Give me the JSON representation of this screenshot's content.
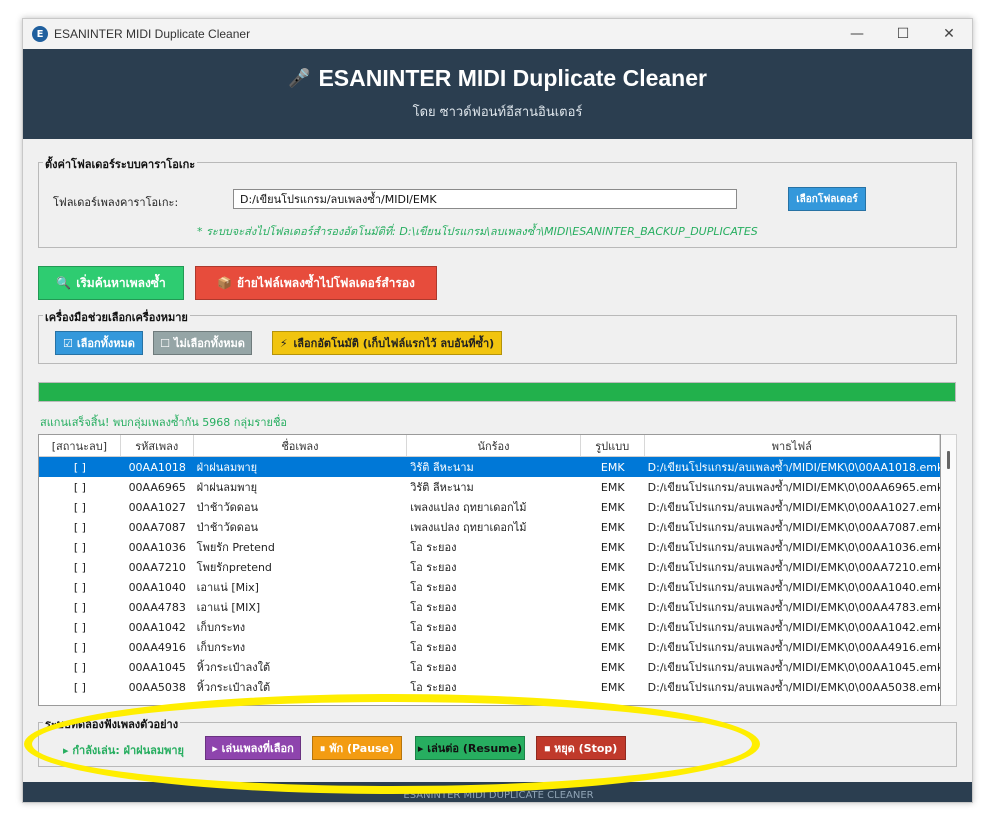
{
  "window": {
    "title": "ESANINTER MIDI Duplicate Cleaner",
    "icon_letter": "E",
    "controls": {
      "minimize": "—",
      "maximize": "☐",
      "close": "✕"
    }
  },
  "header": {
    "title": "ESANINTER MIDI Duplicate Cleaner",
    "icon": "microphone-icon",
    "subtitle": "โดย ซาวด์ฟอนท์อีสานอินเตอร์"
  },
  "folder_settings": {
    "group_title": "ตั้งค่าโฟลเดอร์ระบบคาราโอเกะ",
    "label": "โฟลเดอร์เพลงคาราโอเกะ:",
    "path_value": "D:/เขียนโปรแกรม/ลบเพลงซ้ำ/MIDI/EMK",
    "browse_button": "เลือกโฟลเดอร์",
    "backup_note": "* ระบบจะส่งไปโฟลเดอร์สำรองอัตโนมัติที่: D:\\เขียนโปรแกรม\\ลบเพลงซ้ำ\\MIDI\\ESANINTER_BACKUP_DUPLICATES"
  },
  "actions": {
    "scan_button": "เริ่มค้นหาเพลงซ้ำ",
    "move_button": "ย้ายไฟล์เพลงซ้ำไปโฟลเดอร์สำรอง"
  },
  "select_tools": {
    "group_title": "เครื่องมือช่วยเลือกเครื่องหมาย",
    "select_all": "เลือกทั้งหมด",
    "deselect_all": "ไม่เลือกทั้งหมด",
    "auto_select": "เลือกอัตโนมัติ (เก็บไฟล์แรกไว้ ลบอันที่ซ้ำ)"
  },
  "progress": {
    "fraction": 1.0
  },
  "status": "สแกนเสร็จสิ้น! พบกลุ่มเพลงซ้ำกัน 5968 กลุ่มรายชื่อ",
  "table": {
    "headers": [
      "[สถานะลบ]",
      "รหัสเพลง",
      "ชื่อเพลง",
      "นักร้อง",
      "รูปแบบ",
      "พาธไฟล์"
    ],
    "rows": [
      [
        "[  ]",
        "00AA1018",
        "ฝ่าฝนลมพายุ",
        "วิรัติ ลีหะนาม",
        "EMK",
        "D:/เขียนโปรแกรม/ลบเพลงซ้ำ/MIDI/EMK\\0\\00AA1018.emk"
      ],
      [
        "[  ]",
        "00AA6965",
        "ฝ่าฝนลมพายุ",
        "วิรัติ ลีหะนาม",
        "EMK",
        "D:/เขียนโปรแกรม/ลบเพลงซ้ำ/MIDI/EMK\\0\\00AA6965.emk"
      ],
      [
        "[  ]",
        "00AA1027",
        "ป่าช้าวัดดอน",
        "เพลงแปลง ฤทยาเดอกไม้",
        "EMK",
        "D:/เขียนโปรแกรม/ลบเพลงซ้ำ/MIDI/EMK\\0\\00AA1027.emk"
      ],
      [
        "[  ]",
        "00AA7087",
        "ป่าช้าวัดดอน",
        "เพลงแปลง ฤทยาเดอกไม้",
        "EMK",
        "D:/เขียนโปรแกรม/ลบเพลงซ้ำ/MIDI/EMK\\0\\00AA7087.emk"
      ],
      [
        "[  ]",
        "00AA1036",
        "โพยรัก Pretend",
        "โอ ระยอง",
        "EMK",
        "D:/เขียนโปรแกรม/ลบเพลงซ้ำ/MIDI/EMK\\0\\00AA1036.emk"
      ],
      [
        "[  ]",
        "00AA7210",
        "โพยรักpretend",
        "โอ ระยอง",
        "EMK",
        "D:/เขียนโปรแกรม/ลบเพลงซ้ำ/MIDI/EMK\\0\\00AA7210.emk"
      ],
      [
        "[  ]",
        "00AA1040",
        "เอาแน่ [Mix]",
        "โอ ระยอง",
        "EMK",
        "D:/เขียนโปรแกรม/ลบเพลงซ้ำ/MIDI/EMK\\0\\00AA1040.emk"
      ],
      [
        "[  ]",
        "00AA4783",
        "เอาแน่ [MIX]",
        "โอ ระยอง",
        "EMK",
        "D:/เขียนโปรแกรม/ลบเพลงซ้ำ/MIDI/EMK\\0\\00AA4783.emk"
      ],
      [
        "[  ]",
        "00AA1042",
        "เก็บกระทง",
        "โอ ระยอง",
        "EMK",
        "D:/เขียนโปรแกรม/ลบเพลงซ้ำ/MIDI/EMK\\0\\00AA1042.emk"
      ],
      [
        "[  ]",
        "00AA4916",
        "เก็บกระทง",
        "โอ ระยอง",
        "EMK",
        "D:/เขียนโปรแกรม/ลบเพลงซ้ำ/MIDI/EMK\\0\\00AA4916.emk"
      ],
      [
        "[  ]",
        "00AA1045",
        "หิ้วกระเป๋าลงใต้",
        "โอ ระยอง",
        "EMK",
        "D:/เขียนโปรแกรม/ลบเพลงซ้ำ/MIDI/EMK\\0\\00AA1045.emk"
      ],
      [
        "[  ]",
        "00AA5038",
        "หิ้วกระเป๋าลงใต้",
        "โอ ระยอง",
        "EMK",
        "D:/เขียนโปรแกรม/ลบเพลงซ้ำ/MIDI/EMK\\0\\00AA5038.emk"
      ]
    ]
  },
  "player": {
    "group_title": "ระบบทดลองฟังเพลงตัวอย่าง",
    "now_playing": "▸ กำลังเล่น: ฝ่าฝนลมพายุ",
    "play_selected": "▸ เล่นเพลงที่เลือก",
    "pause": "⏸ พัก (Pause)",
    "resume": "▸ เล่นต่อ (Resume)",
    "stop": "⏹ หยุด (Stop)"
  },
  "footer": {
    "text": "ESANINTER MIDI DUPLICATE CLEANER"
  },
  "colors": {
    "header_bg": "#2b3e50",
    "scan_green": "#2ecc71",
    "move_red": "#e74c3c",
    "browse_blue": "#3498db",
    "select_all_blue": "#3498db",
    "deselect_grey": "#95a5a6",
    "auto_yellow": "#f1c40f",
    "play_purple": "#8e44ad",
    "pause_orange": "#f39c12",
    "resume_green": "#27ae60",
    "stop_red": "#c0392b",
    "progress_green": "#22b14c",
    "highlight_yellow": "#ffee00"
  }
}
